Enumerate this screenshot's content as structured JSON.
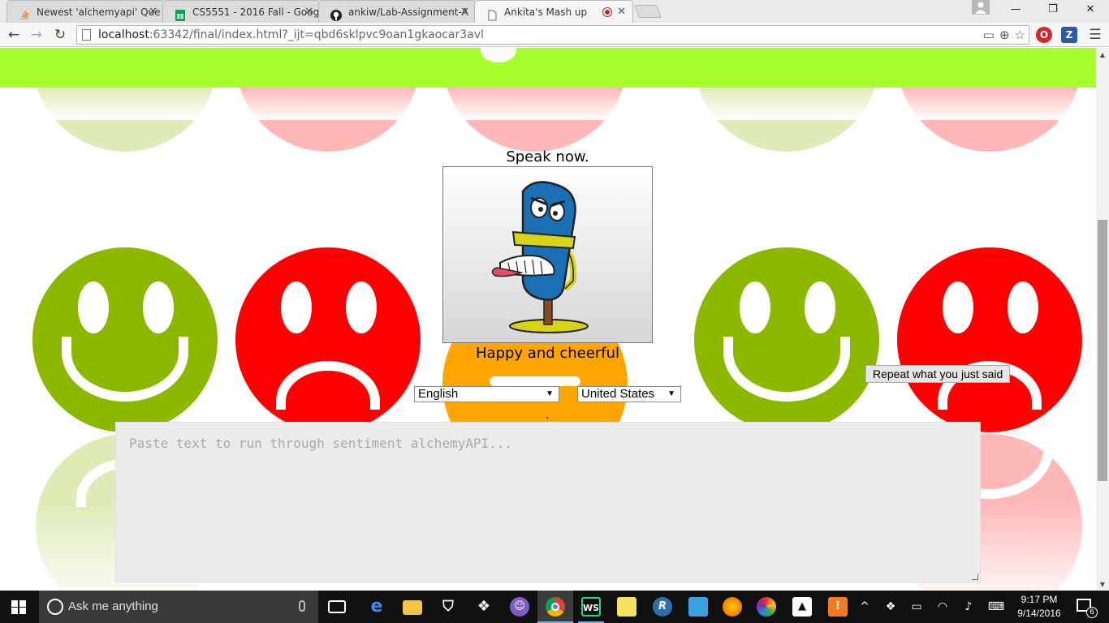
{
  "browser": {
    "tabs": [
      {
        "title": "Newest 'alchemyapi' Que",
        "icon": "stackoverflow-icon",
        "active": false
      },
      {
        "title": "CS5551 - 2016 Fall - Goog",
        "icon": "google-sheets-icon",
        "active": false
      },
      {
        "title": "ankiw/Lab-Assignment-A",
        "icon": "github-icon",
        "active": false
      },
      {
        "title": "Ankita's Mash up",
        "icon": "page-icon",
        "active": true
      }
    ],
    "url_host": "localhost",
    "url_rest": ":63342/final/index.html?_ijt=qbd6sklpvc9oan1gkaocar3avl",
    "extensions": [
      {
        "icon": "opera-icon",
        "color": "#d62828",
        "glyph": "O"
      },
      {
        "icon": "zotero-icon",
        "color": "#2a5aa8",
        "glyph": "Z"
      }
    ]
  },
  "page": {
    "speak_label": "Speak now.",
    "mood_label": "Happy and cheerful",
    "dot_text": ".",
    "language_select": {
      "selected": "English"
    },
    "dialect_select": {
      "selected": "United States"
    },
    "repeat_button": "Repeat what you just said",
    "textarea_placeholder": "Paste text to run through sentiment alchemyAPI...",
    "colors": {
      "header_bar": "#a6ff2b",
      "happy_face": "#8cb800",
      "sad_face": "#ff0000",
      "neutral_face": "#ffa500"
    }
  },
  "taskbar": {
    "search_placeholder": "Ask me anything",
    "clock_time": "9:17 PM",
    "clock_date": "9/14/2016",
    "notification_count": "6",
    "pinned": [
      {
        "icon": "task-view-icon"
      },
      {
        "icon": "edge-icon"
      },
      {
        "icon": "file-explorer-icon"
      },
      {
        "icon": "store-icon"
      },
      {
        "icon": "dropbox-icon"
      },
      {
        "icon": "purple-app-icon"
      },
      {
        "icon": "chrome-icon"
      },
      {
        "icon": "webstorm-icon"
      },
      {
        "icon": "sticky-notes-icon"
      },
      {
        "icon": "r-icon"
      },
      {
        "icon": "app-icon"
      },
      {
        "icon": "firefox-icon"
      },
      {
        "icon": "picasa-icon"
      },
      {
        "icon": "photos-icon"
      }
    ]
  }
}
